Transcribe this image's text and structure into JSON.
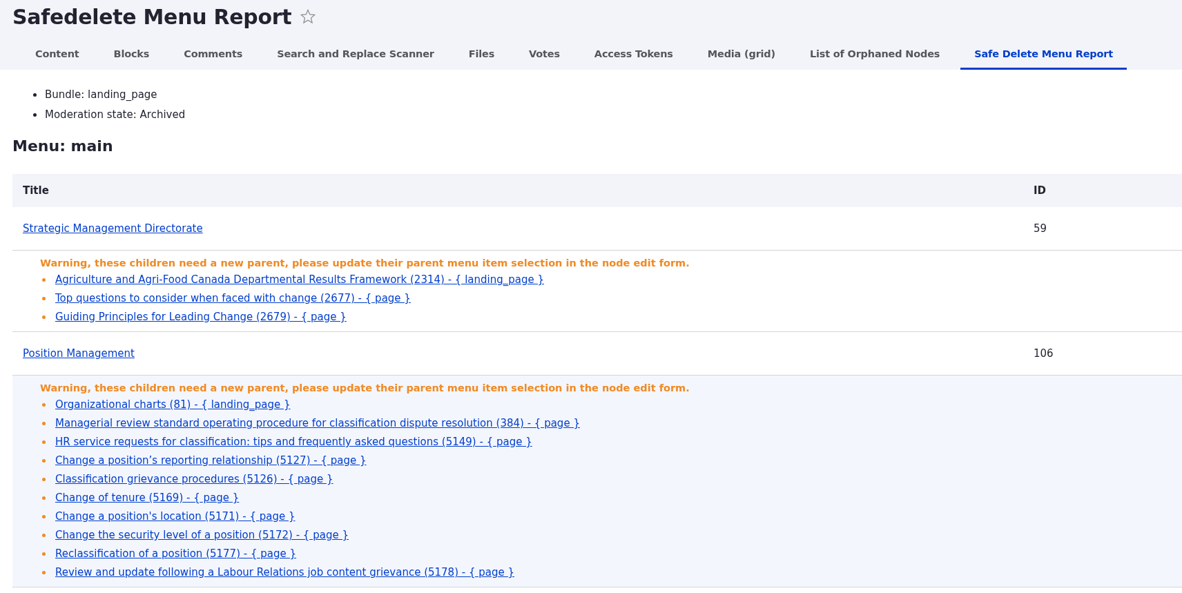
{
  "page_title": "Safedelete Menu Report",
  "tabs": [
    {
      "label": "Content",
      "selected": false
    },
    {
      "label": "Blocks",
      "selected": false
    },
    {
      "label": "Comments",
      "selected": false
    },
    {
      "label": "Search and Replace Scanner",
      "selected": false
    },
    {
      "label": "Files",
      "selected": false
    },
    {
      "label": "Votes",
      "selected": false
    },
    {
      "label": "Access Tokens",
      "selected": false
    },
    {
      "label": "Media (grid)",
      "selected": false
    },
    {
      "label": "List of Orphaned Nodes",
      "selected": false
    },
    {
      "label": "Safe Delete Menu Report",
      "selected": true
    }
  ],
  "details": [
    "Bundle: landing_page",
    "Moderation state: Archived"
  ],
  "menu_heading": "Menu: main",
  "table": {
    "columns": [
      "Title",
      "ID"
    ],
    "rows": [
      {
        "title": "Strategic Management Directorate",
        "id": "59",
        "highlighted": false,
        "warning": "Warning, these children need a new parent, please update their parent menu item selection in the node edit form.",
        "children": [
          "Agriculture and Agri-Food Canada Departmental Results Framework (2314) - { landing_page }",
          "Top questions to consider when faced with change (2677) - { page }",
          "Guiding Principles for Leading Change (2679) - { page }"
        ]
      },
      {
        "title": "Position Management",
        "id": "106",
        "highlighted": true,
        "warning": "Warning, these children need a new parent, please update their parent menu item selection in the node edit form.",
        "children": [
          "Organizational charts (81) - { landing_page }",
          "Managerial review standard operating procedure for classification dispute resolution (384) - { page }",
          "HR service requests for classification: tips and frequently asked questions (5149) - { page }",
          "Change a position’s reporting relationship (5127) - { page }",
          "Classification grievance procedures (5126) - { page }",
          "Change of tenure (5169) - { page }",
          "Change a position's location (5171) - { page }",
          "Change the security level of a position (5172) - { page }",
          "Reclassification of a position (5177) - { page }",
          "Review and update following a Labour Relations job content grievance (5178) - { page }"
        ]
      }
    ]
  }
}
